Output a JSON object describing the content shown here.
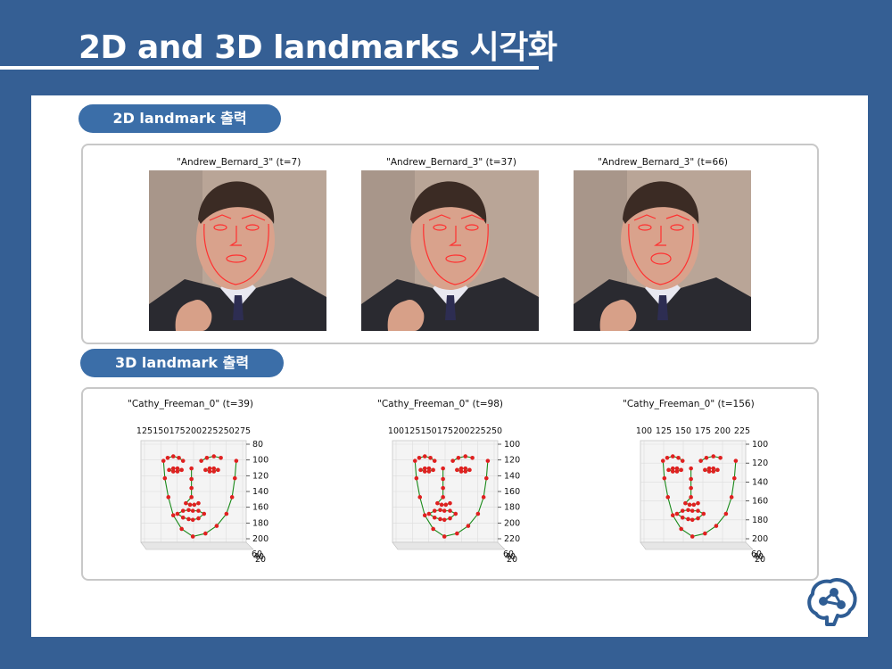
{
  "slide": {
    "title": "2D and 3D landmarks 시각화"
  },
  "section_2d": {
    "label": "2D landmark 출력",
    "frames": [
      {
        "caption": "\"Andrew_Bernard_3\" (t=7)"
      },
      {
        "caption": "\"Andrew_Bernard_3\" (t=37)"
      },
      {
        "caption": "\"Andrew_Bernard_3\" (t=66)"
      }
    ]
  },
  "section_3d": {
    "label": "3D landmark 출력",
    "plots": [
      {
        "caption": "\"Cathy_Freeman_0\" (t=39)",
        "x_ticks": [
          "125",
          "150",
          "175",
          "200",
          "225",
          "250",
          "275"
        ],
        "y_ticks": [
          "80",
          "100",
          "120",
          "140",
          "160",
          "180",
          "200"
        ],
        "z_ticks": [
          "60",
          "40",
          "20"
        ]
      },
      {
        "caption": "\"Cathy_Freeman_0\" (t=98)",
        "x_ticks": [
          "100",
          "125",
          "150",
          "175",
          "200",
          "225",
          "250"
        ],
        "y_ticks": [
          "100",
          "120",
          "140",
          "160",
          "180",
          "200",
          "220"
        ],
        "z_ticks": [
          "60",
          "40",
          "20"
        ]
      },
      {
        "caption": "\"Cathy_Freeman_0\" (t=156)",
        "x_ticks": [
          "100",
          "125",
          "150",
          "175",
          "200",
          "225"
        ],
        "y_ticks": [
          "100",
          "120",
          "140",
          "160",
          "180",
          "200"
        ],
        "z_ticks": [
          "60",
          "40",
          "20"
        ]
      }
    ]
  },
  "colors": {
    "background": "#355f94",
    "pill": "#3b6ea8",
    "landmark_point": "#e02020",
    "landmark_line": "#1a8a1a",
    "logo": "#2f5d94"
  },
  "icons": {
    "logo": "brain-network-logo"
  }
}
